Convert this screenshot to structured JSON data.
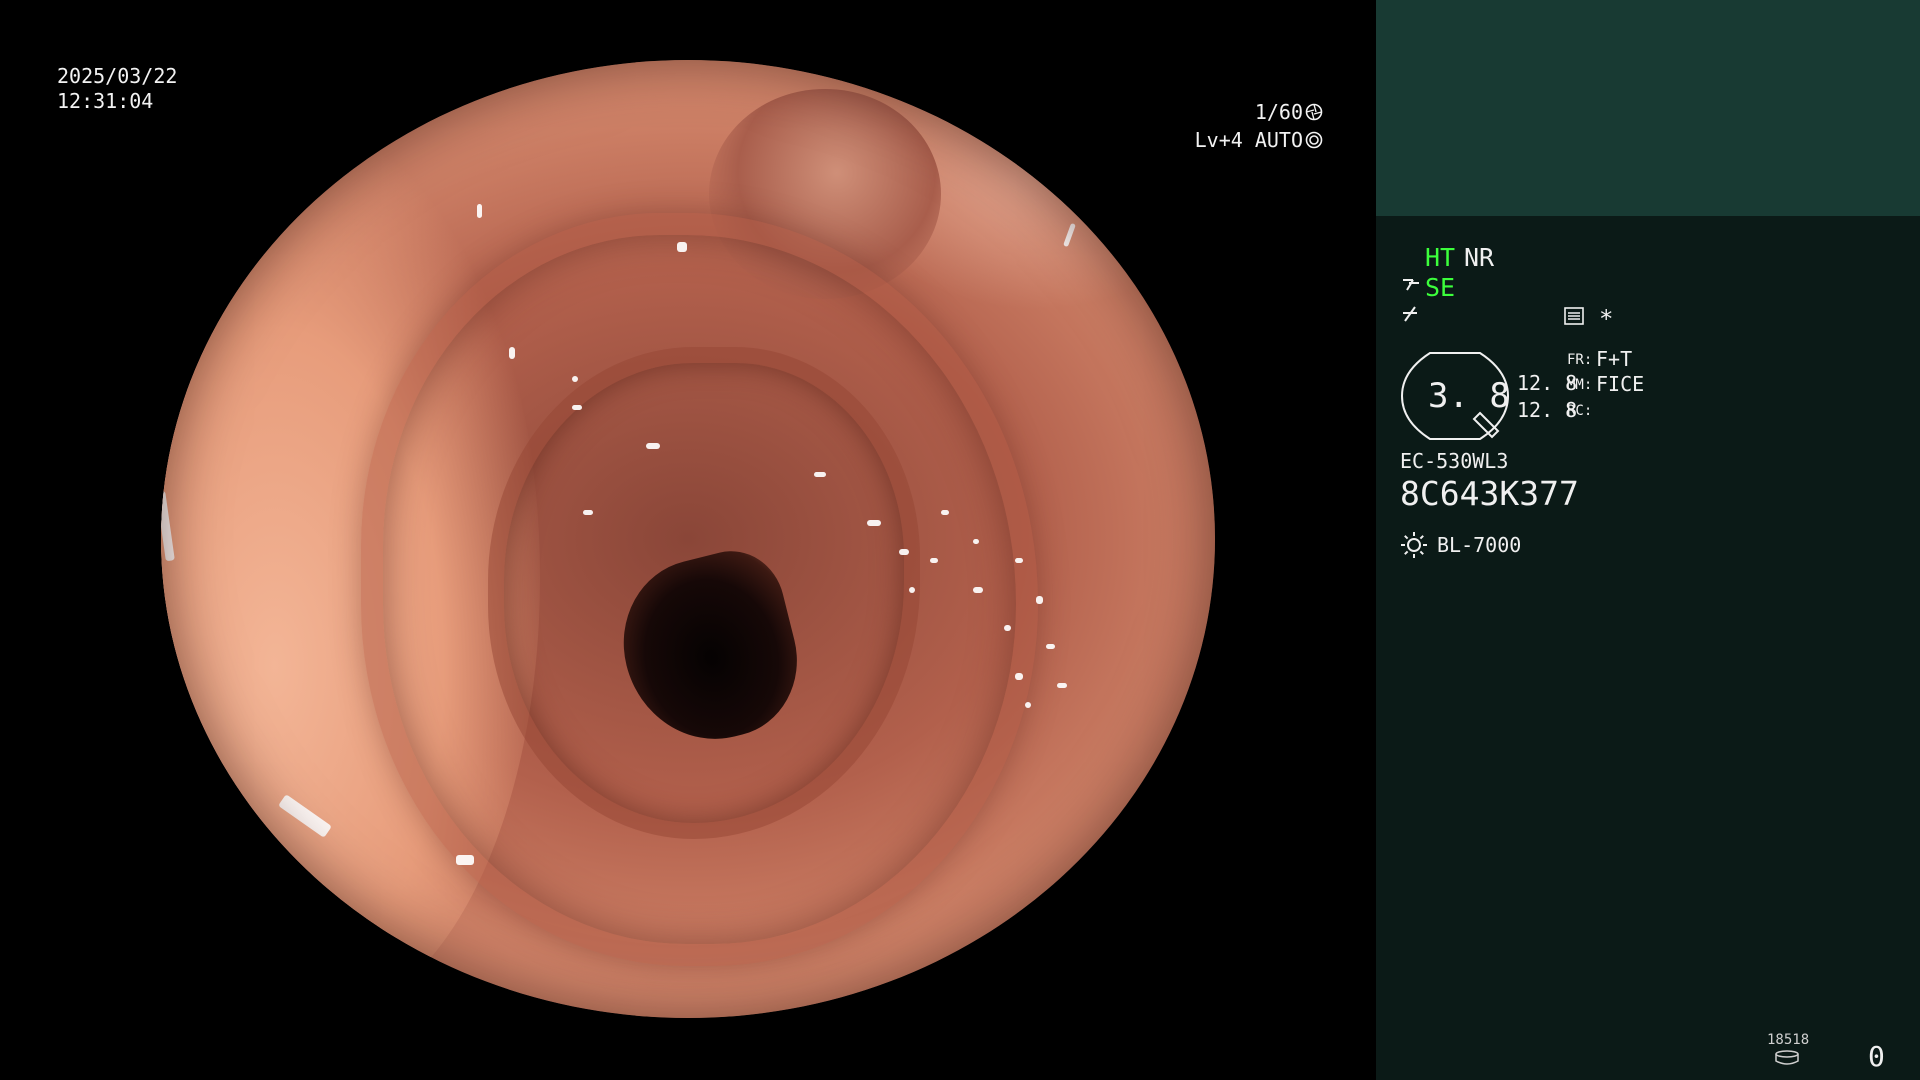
{
  "overlay": {
    "date": "2025/03/22",
    "time": "12:31:04",
    "shutter": "1/60",
    "light_level": "Lv+4 AUTO",
    "icons": {
      "shutter": "aperture-icon",
      "light": "light-ring-icon"
    }
  },
  "panel": {
    "ht": "HT",
    "nr": "NR",
    "se": "SE",
    "star": "*",
    "zoom_value": "3. 8",
    "value_a": "12. 8",
    "value_b": "12. 8",
    "fr_key": "FR:",
    "fr_value": "F+T",
    "mm_key": "MM:",
    "mm_value": "FICE",
    "rc_key": "RC:",
    "scope_model": "EC-530WL3",
    "scope_serial": "8C643K377",
    "light_source": "BL-7000",
    "counter_small": "18518",
    "counter_big": "0",
    "colors": {
      "active_green": "#3cff3c",
      "panel_bg": "#0b1a17",
      "panel_top_bg": "#183a33"
    }
  }
}
